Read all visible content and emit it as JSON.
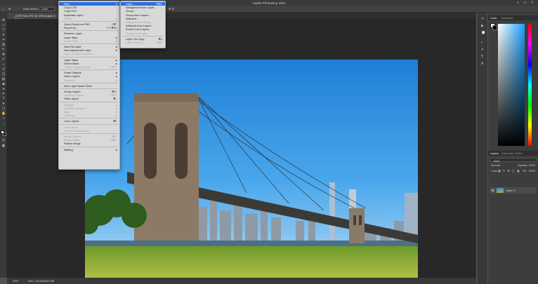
{
  "window": {
    "title": "Adobe Photoshop 2021"
  },
  "options_bar": {
    "auto_select_label": "Auto-Select:",
    "auto_select_value": "Layer"
  },
  "document": {
    "tab_label": "_DSF7318.CR2 @ 33% (Layer 0, RGB/8)"
  },
  "status": {
    "zoom": "33%",
    "doc_size": "Doc: 143.4M/143.4M"
  },
  "layer_menu": {
    "items": [
      {
        "label": "New",
        "arrow": "▸",
        "hl": true
      },
      {
        "label": "Copy CSS"
      },
      {
        "label": "Copy SVG"
      },
      {
        "label": "Duplicate Layer..."
      },
      {
        "label": "Delete",
        "arrow": "▸",
        "dis": true
      },
      {
        "label": "Quick Export as PNG",
        "sc": "⇧⌘'"
      },
      {
        "label": "Export As...",
        "sc": "⌥⇧⌘W"
      },
      {
        "label": "Rename Layer..."
      },
      {
        "label": "Layer Style",
        "arrow": "▸"
      },
      {
        "label": "Smart Filter",
        "arrow": "▸",
        "dis": true
      },
      {
        "label": "New Fill Layer",
        "arrow": "▸"
      },
      {
        "label": "New Adjustment Layer",
        "arrow": "▸"
      },
      {
        "label": "Layer Content Options...",
        "dis": true
      },
      {
        "label": "Layer Mask",
        "arrow": "▸"
      },
      {
        "label": "Vector Mask",
        "arrow": "▸"
      },
      {
        "label": "Create Clipping Mask",
        "sc": "⌥⌘G",
        "dis": true
      },
      {
        "label": "Smart Objects",
        "arrow": "▸"
      },
      {
        "label": "Video Layers",
        "arrow": "▸"
      },
      {
        "label": "Rasterize",
        "arrow": "▸",
        "dis": true
      },
      {
        "label": "New Layer Based Slice"
      },
      {
        "label": "Group Layers",
        "sc": "⌘G"
      },
      {
        "label": "Ungroup Layers",
        "sc": "⇧⌘G",
        "dis": true
      },
      {
        "label": "Hide Layers",
        "sc": "⌘,"
      },
      {
        "label": "Arrange",
        "arrow": "▸",
        "dis": true
      },
      {
        "label": "Combine Shapes",
        "arrow": "▸",
        "dis": true
      },
      {
        "label": "Align",
        "arrow": "▸",
        "dis": true
      },
      {
        "label": "Distribute",
        "arrow": "▸",
        "dis": true
      },
      {
        "label": "Lock Layers...",
        "sc": "⌘/"
      },
      {
        "label": "Link Layers",
        "dis": true
      },
      {
        "label": "Select Linked Layers",
        "dis": true
      },
      {
        "label": "Merge Layers",
        "sc": "⌘E",
        "dis": true
      },
      {
        "label": "Merge Visible",
        "sc": "⇧⌘E",
        "dis": true
      },
      {
        "label": "Flatten Image"
      },
      {
        "label": "Matting",
        "arrow": "▸"
      }
    ]
  },
  "new_submenu": {
    "items": [
      {
        "label": "Layer...",
        "sc": "⇧⌘N",
        "hl": true
      },
      {
        "label": "Background from Layer..."
      },
      {
        "label": "Group..."
      },
      {
        "label": "Group from Layers..."
      },
      {
        "label": "Artboard..."
      },
      {
        "label": "Artboard from Group...",
        "dis": true
      },
      {
        "label": "Artboard from Layers..."
      },
      {
        "label": "Frame from Layers..."
      },
      {
        "label": "Convert to Frame",
        "dis": true
      },
      {
        "label": "Layer Via Copy",
        "sc": "⌘J"
      },
      {
        "label": "Layer Via Cut",
        "sc": "⇧⌘J",
        "dis": true
      }
    ]
  },
  "panels": {
    "color_tab": "Color",
    "swatches_tab": "Swatches",
    "layers_tab": "Layers",
    "channels_tab": "Channels",
    "paths_tab": "Paths",
    "kind_label": "Kind",
    "blend_mode": "Normal",
    "opacity_label": "Opacity:",
    "opacity_value": "100%",
    "lock_label": "Lock:",
    "fill_label": "Fill:",
    "fill_value": "100%",
    "layer_name": "Layer 0"
  }
}
